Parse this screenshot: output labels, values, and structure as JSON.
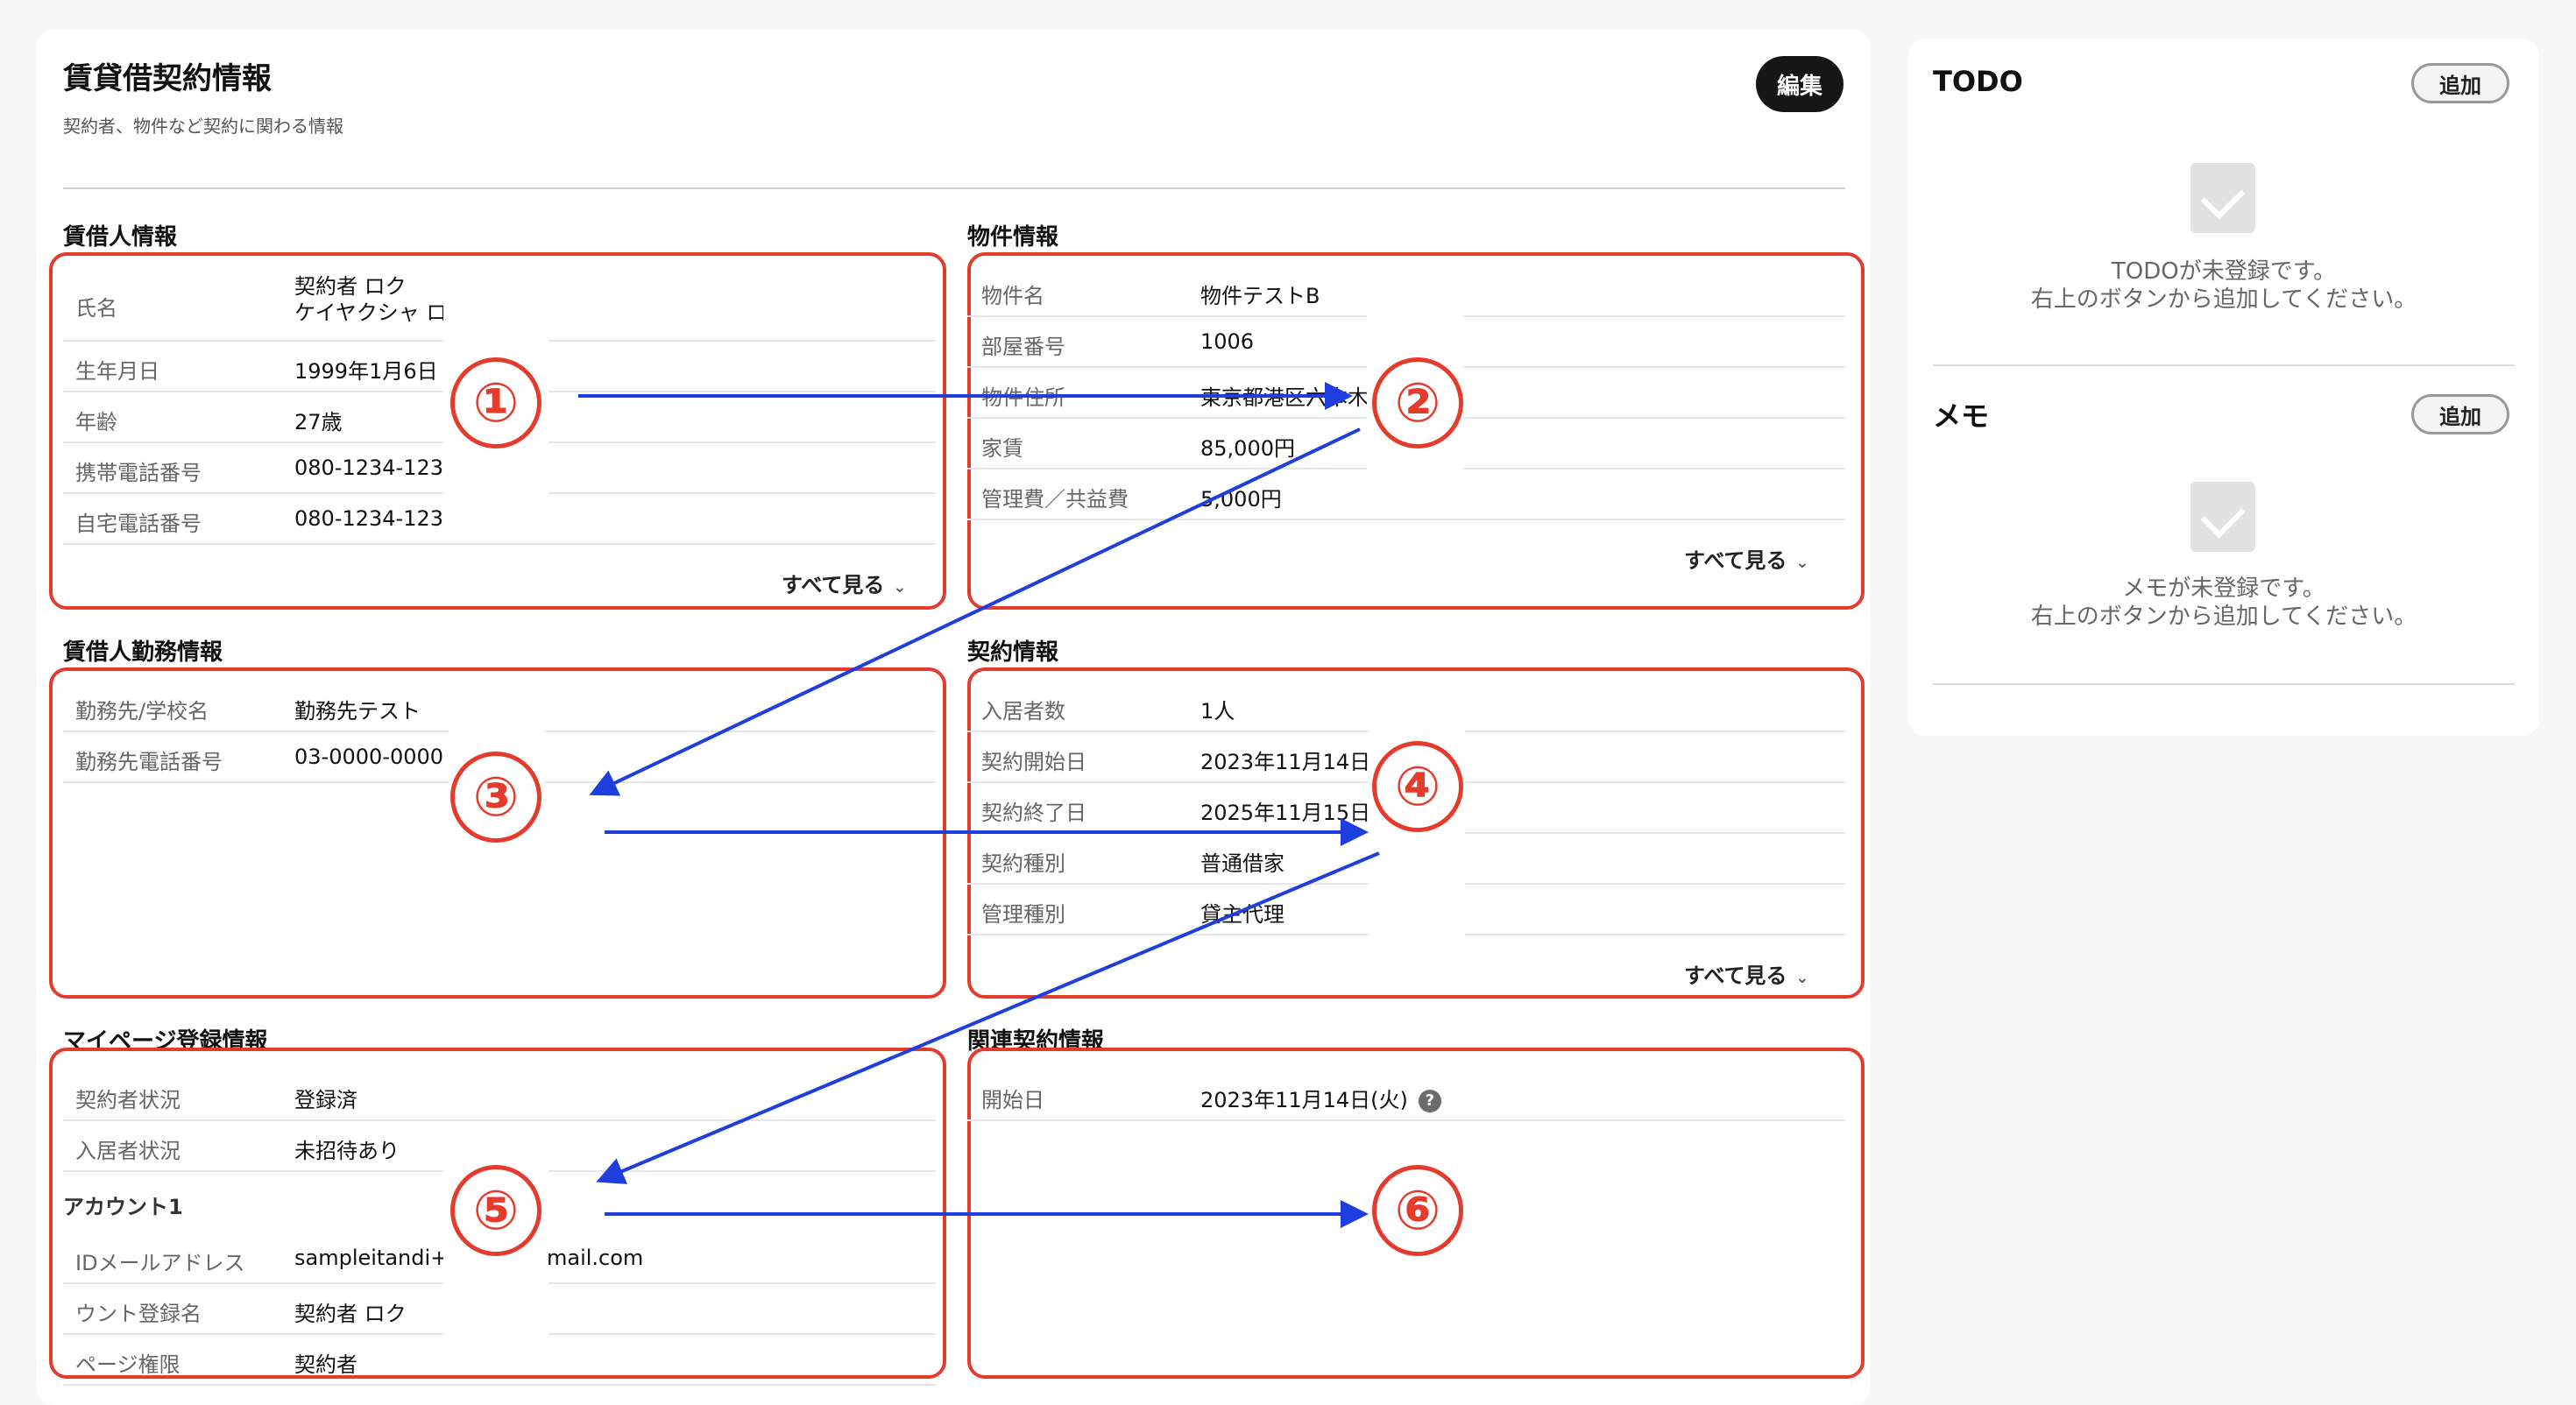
{
  "header": {
    "title": "賃貸借契約情報",
    "subtitle": "契約者、物件など契約に関わる情報",
    "edit_label": "編集"
  },
  "sections": {
    "tenant": {
      "title": "賃借人情報",
      "rows": [
        {
          "label": "氏名",
          "value": "契約者 ロク",
          "value2": "ケイヤクシャ ロク"
        },
        {
          "label": "生年月日",
          "value": "1999年1月6日"
        },
        {
          "label": "年齢",
          "value": "27歳"
        },
        {
          "label": "携帯電話番号",
          "value": "080-1234-123"
        },
        {
          "label": "自宅電話番号",
          "value": "080-1234-123"
        }
      ],
      "see_all": "すべて見る"
    },
    "property": {
      "title": "物件情報",
      "rows": [
        {
          "label": "物件名",
          "value": "物件テストB"
        },
        {
          "label": "部屋番号",
          "value": "1006"
        },
        {
          "label": "物件住所",
          "value": "東京都港区六本木"
        },
        {
          "label": "家賃",
          "value": "85,000円"
        },
        {
          "label": "管理費／共益費",
          "value": "5,000円"
        }
      ],
      "see_all": "すべて見る"
    },
    "employment": {
      "title": "賃借人勤務情報",
      "rows": [
        {
          "label": "勤務先/学校名",
          "value": "勤務先テスト"
        },
        {
          "label": "勤務先電話番号",
          "value": "03-0000-0000"
        }
      ]
    },
    "contract": {
      "title": "契約情報",
      "rows": [
        {
          "label": "入居者数",
          "value": "1人"
        },
        {
          "label": "契約開始日",
          "value": "2023年11月14日("
        },
        {
          "label": "契約終了日",
          "value": "2025年11月15日("
        },
        {
          "label": "契約種別",
          "value": "普通借家"
        },
        {
          "label": "管理種別",
          "value": "貸主代理"
        }
      ],
      "see_all": "すべて見る"
    },
    "mypage": {
      "title": "マイページ登録情報",
      "rows": [
        {
          "label": "契約者状況",
          "value": "登録済"
        },
        {
          "label": "入居者状況",
          "value": "未招待あり"
        }
      ],
      "account_heading": "アカウント1",
      "account_rows": [
        {
          "label": "IDメールアドレス",
          "value": "sampleitandi+2",
          "value_suffix": "mail.com"
        },
        {
          "label": "ウント登録名",
          "value": "契約者 ロク"
        },
        {
          "label": "ページ権限",
          "value": "契約者"
        }
      ]
    },
    "related": {
      "title": "関連契約情報",
      "rows": [
        {
          "label": "開始日",
          "value": "2023年11月14日(火)",
          "help": "?"
        }
      ]
    }
  },
  "side": {
    "todo": {
      "title": "TODO",
      "add_label": "追加",
      "empty_line1": "TODOが未登録です。",
      "empty_line2": "右上のボタンから追加してください。"
    },
    "memo": {
      "title": "メモ",
      "add_label": "追加",
      "empty_line1": "メモが未登録です。",
      "empty_line2": "右上のボタンから追加してください。"
    }
  },
  "annotations": [
    "①",
    "②",
    "③",
    "④",
    "⑤",
    "⑥"
  ],
  "colors": {
    "annotation_box": "#e53b2c",
    "arrow": "#1f3ee0",
    "edit_button": "#161616"
  }
}
